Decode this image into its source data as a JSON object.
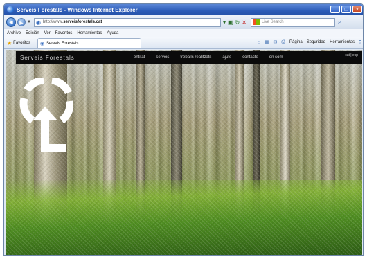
{
  "window": {
    "title": "Serveis Forestals - Windows Internet Explorer",
    "controls": [
      "_",
      "□",
      "×"
    ]
  },
  "address": {
    "url_prefix": "http://www.",
    "url_domain": "serveisforestals.cat",
    "search_placeholder": "Live Search"
  },
  "menu": [
    "Archivo",
    "Edición",
    "Ver",
    "Favoritos",
    "Herramientas",
    "Ayuda"
  ],
  "favorites": {
    "label": "Favoritos",
    "tab_title": "Serveis Forestals",
    "commands": [
      "Página",
      "Seguridad",
      "Herramientas"
    ]
  },
  "site": {
    "name": "Serveis Forestals",
    "nav": [
      "entitat",
      "serveis",
      "treballs realitzats",
      "ajuts",
      "contacte",
      "on som"
    ],
    "lang": "cat | esp"
  },
  "colors": {
    "titlebar": "#2c5cb8",
    "site_bar": "#0b0b0b",
    "logo": "#ffffff"
  }
}
